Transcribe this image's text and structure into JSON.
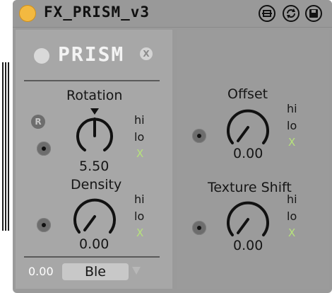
{
  "device": {
    "title": "FX_PRISM_v3",
    "logo": "PRISM",
    "logo_close": "X",
    "accent_power": "#f3b940",
    "accent_x": "#b6e27b"
  },
  "controls": {
    "rotation": {
      "label": "Rotation",
      "value": "5.50",
      "hi": "hi",
      "lo": "lo",
      "x": "X",
      "r_badge": "R"
    },
    "density": {
      "label": "Density",
      "value": "0.00",
      "hi": "hi",
      "lo": "lo",
      "x": "X"
    },
    "offset": {
      "label": "Offset",
      "value": "0.00",
      "hi": "hi",
      "lo": "lo",
      "x": "X"
    },
    "texture_shift": {
      "label": "Texture Shift",
      "value": "0.00",
      "hi": "hi",
      "lo": "lo",
      "x": "X"
    }
  },
  "footer": {
    "value": "0.00",
    "mode": "Ble"
  }
}
